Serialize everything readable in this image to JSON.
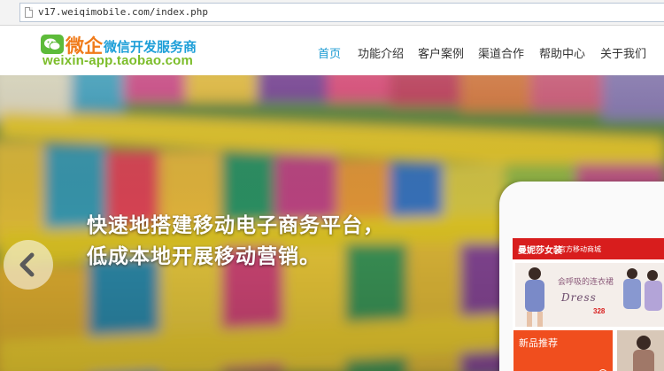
{
  "browser": {
    "url": "v17.weiqimobile.com/index.php"
  },
  "brand": {
    "name": "微企",
    "tagline": "微信开发服务商",
    "domain": "weixin-app.taobao.com",
    "colors": {
      "name": "#f07b1a",
      "tagline": "#1e9fd8",
      "domain": "#7cbd2a",
      "icon": "#5dbb3a"
    }
  },
  "nav": {
    "items": [
      {
        "label": "首页",
        "active": true
      },
      {
        "label": "功能介绍",
        "active": false
      },
      {
        "label": "客户案例",
        "active": false
      },
      {
        "label": "渠道合作",
        "active": false
      },
      {
        "label": "帮助中心",
        "active": false
      },
      {
        "label": "关于我们",
        "active": false
      }
    ],
    "active_color": "#1a9ad2"
  },
  "hero": {
    "line1": "快速地搭建移动电子商务平台，",
    "line2": "低成本地开展移动营销。",
    "prev_icon": "chevron-left-icon"
  },
  "phone": {
    "shop_name": "曼妮莎女装",
    "shop_subtitle": "官方移动商城",
    "banner_line1": "会呼吸的连衣裙",
    "banner_line2": "Dress",
    "banner_price": "328",
    "new_products": "新品推荐",
    "accent": "#d81d1d"
  }
}
